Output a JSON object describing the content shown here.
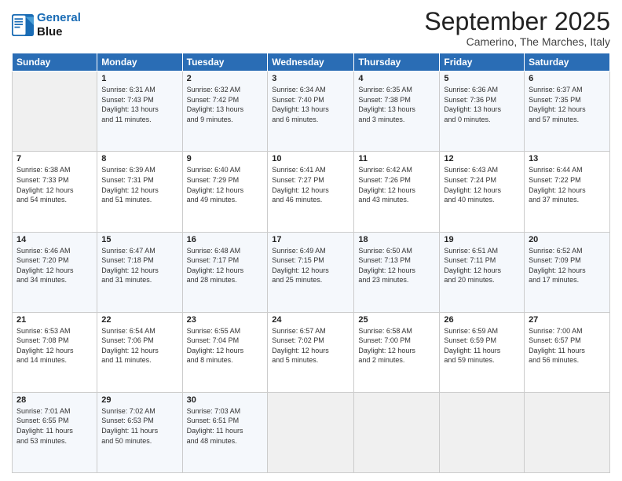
{
  "header": {
    "logo_line1": "General",
    "logo_line2": "Blue",
    "month": "September 2025",
    "location": "Camerino, The Marches, Italy"
  },
  "weekdays": [
    "Sunday",
    "Monday",
    "Tuesday",
    "Wednesday",
    "Thursday",
    "Friday",
    "Saturday"
  ],
  "weeks": [
    [
      {
        "day": "",
        "info": ""
      },
      {
        "day": "1",
        "info": "Sunrise: 6:31 AM\nSunset: 7:43 PM\nDaylight: 13 hours\nand 11 minutes."
      },
      {
        "day": "2",
        "info": "Sunrise: 6:32 AM\nSunset: 7:42 PM\nDaylight: 13 hours\nand 9 minutes."
      },
      {
        "day": "3",
        "info": "Sunrise: 6:34 AM\nSunset: 7:40 PM\nDaylight: 13 hours\nand 6 minutes."
      },
      {
        "day": "4",
        "info": "Sunrise: 6:35 AM\nSunset: 7:38 PM\nDaylight: 13 hours\nand 3 minutes."
      },
      {
        "day": "5",
        "info": "Sunrise: 6:36 AM\nSunset: 7:36 PM\nDaylight: 13 hours\nand 0 minutes."
      },
      {
        "day": "6",
        "info": "Sunrise: 6:37 AM\nSunset: 7:35 PM\nDaylight: 12 hours\nand 57 minutes."
      }
    ],
    [
      {
        "day": "7",
        "info": "Sunrise: 6:38 AM\nSunset: 7:33 PM\nDaylight: 12 hours\nand 54 minutes."
      },
      {
        "day": "8",
        "info": "Sunrise: 6:39 AM\nSunset: 7:31 PM\nDaylight: 12 hours\nand 51 minutes."
      },
      {
        "day": "9",
        "info": "Sunrise: 6:40 AM\nSunset: 7:29 PM\nDaylight: 12 hours\nand 49 minutes."
      },
      {
        "day": "10",
        "info": "Sunrise: 6:41 AM\nSunset: 7:27 PM\nDaylight: 12 hours\nand 46 minutes."
      },
      {
        "day": "11",
        "info": "Sunrise: 6:42 AM\nSunset: 7:26 PM\nDaylight: 12 hours\nand 43 minutes."
      },
      {
        "day": "12",
        "info": "Sunrise: 6:43 AM\nSunset: 7:24 PM\nDaylight: 12 hours\nand 40 minutes."
      },
      {
        "day": "13",
        "info": "Sunrise: 6:44 AM\nSunset: 7:22 PM\nDaylight: 12 hours\nand 37 minutes."
      }
    ],
    [
      {
        "day": "14",
        "info": "Sunrise: 6:46 AM\nSunset: 7:20 PM\nDaylight: 12 hours\nand 34 minutes."
      },
      {
        "day": "15",
        "info": "Sunrise: 6:47 AM\nSunset: 7:18 PM\nDaylight: 12 hours\nand 31 minutes."
      },
      {
        "day": "16",
        "info": "Sunrise: 6:48 AM\nSunset: 7:17 PM\nDaylight: 12 hours\nand 28 minutes."
      },
      {
        "day": "17",
        "info": "Sunrise: 6:49 AM\nSunset: 7:15 PM\nDaylight: 12 hours\nand 25 minutes."
      },
      {
        "day": "18",
        "info": "Sunrise: 6:50 AM\nSunset: 7:13 PM\nDaylight: 12 hours\nand 23 minutes."
      },
      {
        "day": "19",
        "info": "Sunrise: 6:51 AM\nSunset: 7:11 PM\nDaylight: 12 hours\nand 20 minutes."
      },
      {
        "day": "20",
        "info": "Sunrise: 6:52 AM\nSunset: 7:09 PM\nDaylight: 12 hours\nand 17 minutes."
      }
    ],
    [
      {
        "day": "21",
        "info": "Sunrise: 6:53 AM\nSunset: 7:08 PM\nDaylight: 12 hours\nand 14 minutes."
      },
      {
        "day": "22",
        "info": "Sunrise: 6:54 AM\nSunset: 7:06 PM\nDaylight: 12 hours\nand 11 minutes."
      },
      {
        "day": "23",
        "info": "Sunrise: 6:55 AM\nSunset: 7:04 PM\nDaylight: 12 hours\nand 8 minutes."
      },
      {
        "day": "24",
        "info": "Sunrise: 6:57 AM\nSunset: 7:02 PM\nDaylight: 12 hours\nand 5 minutes."
      },
      {
        "day": "25",
        "info": "Sunrise: 6:58 AM\nSunset: 7:00 PM\nDaylight: 12 hours\nand 2 minutes."
      },
      {
        "day": "26",
        "info": "Sunrise: 6:59 AM\nSunset: 6:59 PM\nDaylight: 11 hours\nand 59 minutes."
      },
      {
        "day": "27",
        "info": "Sunrise: 7:00 AM\nSunset: 6:57 PM\nDaylight: 11 hours\nand 56 minutes."
      }
    ],
    [
      {
        "day": "28",
        "info": "Sunrise: 7:01 AM\nSunset: 6:55 PM\nDaylight: 11 hours\nand 53 minutes."
      },
      {
        "day": "29",
        "info": "Sunrise: 7:02 AM\nSunset: 6:53 PM\nDaylight: 11 hours\nand 50 minutes."
      },
      {
        "day": "30",
        "info": "Sunrise: 7:03 AM\nSunset: 6:51 PM\nDaylight: 11 hours\nand 48 minutes."
      },
      {
        "day": "",
        "info": ""
      },
      {
        "day": "",
        "info": ""
      },
      {
        "day": "",
        "info": ""
      },
      {
        "day": "",
        "info": ""
      }
    ]
  ]
}
